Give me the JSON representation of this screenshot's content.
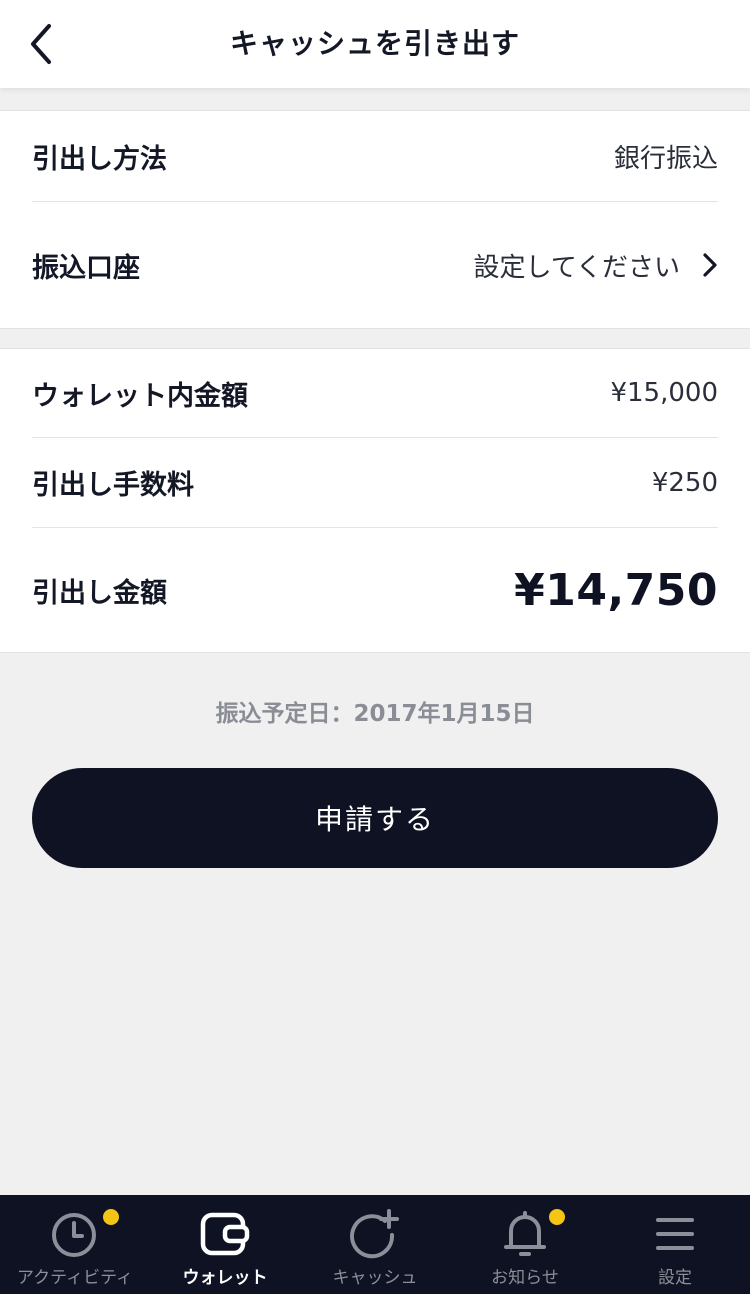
{
  "header": {
    "title": "キャッシュを引き出す",
    "back_icon": "chevron-left-icon"
  },
  "method_section": {
    "method": {
      "label": "引出し方法",
      "value": "銀行振込"
    },
    "account": {
      "label": "振込口座",
      "value": "設定してください"
    }
  },
  "amount_section": {
    "wallet": {
      "label": "ウォレット内金額",
      "value": "¥15,000"
    },
    "fee": {
      "label": "引出し手数料",
      "value": "¥250"
    },
    "total": {
      "label": "引出し金額",
      "value": "¥14,750"
    }
  },
  "schedule_text": "振込予定日：2017年1月15日",
  "submit_label": "申請する",
  "tabbar": {
    "items": [
      {
        "label": "アクティビティ",
        "icon": "clock-icon",
        "badge": true
      },
      {
        "label": "ウォレット",
        "icon": "wallet-icon",
        "active": true
      },
      {
        "label": "キャッシュ",
        "icon": "cash-plus-icon"
      },
      {
        "label": "お知らせ",
        "icon": "bell-icon",
        "badge": true
      },
      {
        "label": "設定",
        "icon": "menu-icon"
      }
    ]
  },
  "colors": {
    "dark_navy": "#0e1222",
    "badge_yellow": "#f5c515",
    "background": "#f0f0f0"
  }
}
